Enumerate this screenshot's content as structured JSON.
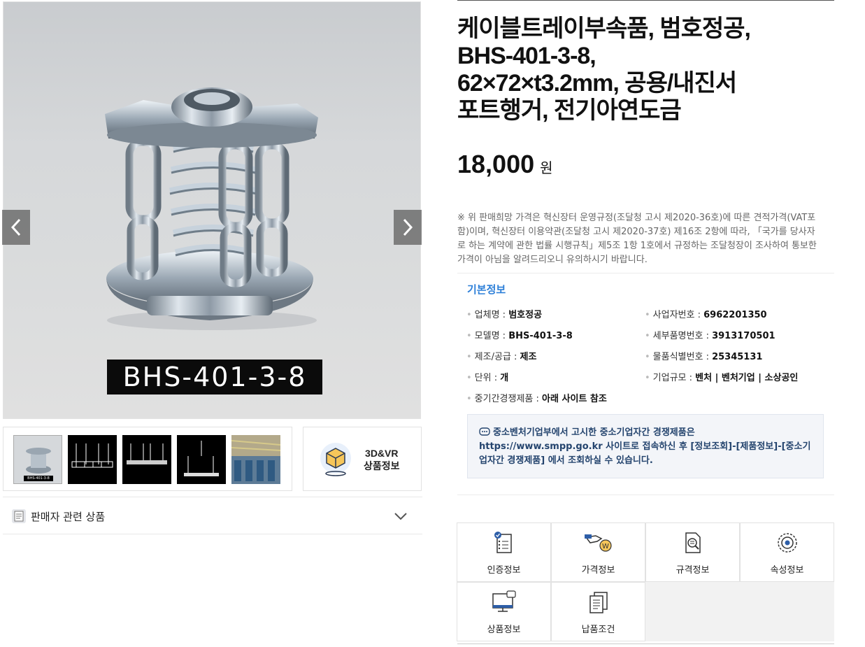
{
  "gallery": {
    "caption": "BHS-401-3-8",
    "prev_icon": "chevron-left-icon",
    "next_icon": "chevron-right-icon",
    "thumb_caption": "BHS-401-3-8",
    "vr_label": "3D&VR\n상품정보",
    "vr_icon": "3d-box-icon"
  },
  "seller": {
    "label": "판매자 관련 상품",
    "icon": "list-icon",
    "toggle_icon": "chevron-down-icon"
  },
  "product": {
    "title": "케이블트레이부속품, 범호정공, BHS-401-3-8, 62×72×t3.2mm, 공용/내진서포트행거, 전기아연도금",
    "price": "18,000",
    "price_unit": "원",
    "notice": "※ 위 판매희망 가격은 혁신장터 운영규정(조달청 고시 제2020-36호)에 따른 견적가격(VAT포함)이며, 혁신장터 이용약관(조달청 고시 제2020-37호) 제16조 2항에 따라, 「국가를 당사자로 하는 계약에 관한 법률 시행규칙」제5조 1항 1호에서 규정하는 조달청장이 조사하여 통보한 가격이 아님을 알려드리오니 유의하시기 바랍니다."
  },
  "basic_info": {
    "title": "기본정보",
    "items": [
      {
        "label": "업체명 : ",
        "value": "범호정공"
      },
      {
        "label": "사업자번호 : ",
        "value": "6962201350"
      },
      {
        "label": "모델명 : ",
        "value": "BHS-401-3-8"
      },
      {
        "label": "세부품명번호 : ",
        "value": "3913170501"
      },
      {
        "label": "제조/공급 : ",
        "value": "제조"
      },
      {
        "label": "물품식별번호 : ",
        "value": "25345131"
      },
      {
        "label": "단위 : ",
        "value": "개"
      },
      {
        "label": "기업규모 : ",
        "value": "벤처 | 벤처기업 | 소상공인"
      },
      {
        "label": "중기간경쟁제품 : ",
        "value": "아래 사이트 참조"
      }
    ]
  },
  "sme_notice": {
    "icon": "speech-bubble-icon",
    "text": "중소벤처기업부에서 고시한 중소기업자간 경쟁제품은 https://www.smpp.go.kr 사이트로 접속하신 후 [정보조회]-[제품정보]-[중소기업자간 경쟁제품] 에서 조회하실 수 있습니다."
  },
  "tiles": [
    {
      "label": "인증정보",
      "icon": "certificate-icon"
    },
    {
      "label": "가격정보",
      "icon": "price-hand-icon"
    },
    {
      "label": "규격정보",
      "icon": "document-search-icon"
    },
    {
      "label": "속성정보",
      "icon": "gear-icon"
    },
    {
      "label": "상품정보",
      "icon": "monitor-icon"
    },
    {
      "label": "납품조건",
      "icon": "documents-icon"
    }
  ],
  "colors": {
    "accent": "#2d7fd8",
    "notice_text": "#24446e",
    "notice_bg": "#f3f5f9"
  }
}
